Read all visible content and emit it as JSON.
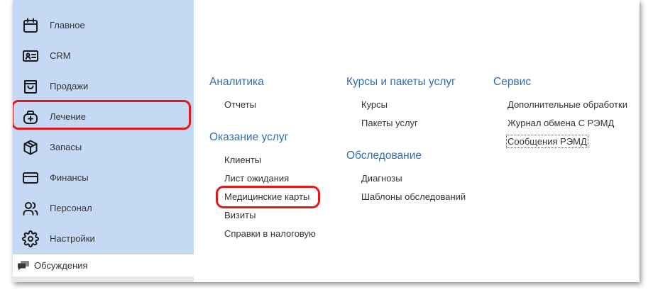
{
  "sidebar": {
    "items": [
      {
        "label": "Главное",
        "icon": "calendar-icon"
      },
      {
        "label": "CRM",
        "icon": "id-card-icon"
      },
      {
        "label": "Продажи",
        "icon": "shopping-bag-icon"
      },
      {
        "label": "Лечение",
        "icon": "medical-bag-icon"
      },
      {
        "label": "Запасы",
        "icon": "box-icon"
      },
      {
        "label": "Финансы",
        "icon": "credit-card-icon"
      },
      {
        "label": "Персонал",
        "icon": "users-icon"
      },
      {
        "label": "Настройки",
        "icon": "gear-icon"
      }
    ],
    "discussions": {
      "label": "Обсуждения",
      "icon": "chat-bubbles-icon"
    }
  },
  "content": {
    "columns": [
      {
        "sections": [
          {
            "title": "Аналитика",
            "links": [
              "Отчеты"
            ]
          },
          {
            "title": "Оказание услуг",
            "links": [
              "Клиенты",
              "Лист ожидания",
              "Медицинские карты",
              "Визиты",
              "Справки в налоговую"
            ]
          }
        ]
      },
      {
        "sections": [
          {
            "title": "Курсы и пакеты услуг",
            "links": [
              "Курсы",
              "Пакеты услуг"
            ]
          },
          {
            "title": "Обследование",
            "links": [
              "Диагнозы",
              "Шаблоны обследований"
            ]
          }
        ]
      },
      {
        "sections": [
          {
            "title": "Сервис",
            "links": [
              "Дополнительные обработки",
              "Журнал обмена С РЭМД",
              "Сообщения РЭМД"
            ]
          }
        ]
      }
    ]
  },
  "colors": {
    "sidebar_bg": "#c5d9f5",
    "section_title": "#2f6fb7",
    "highlight": "#e01a1a"
  }
}
